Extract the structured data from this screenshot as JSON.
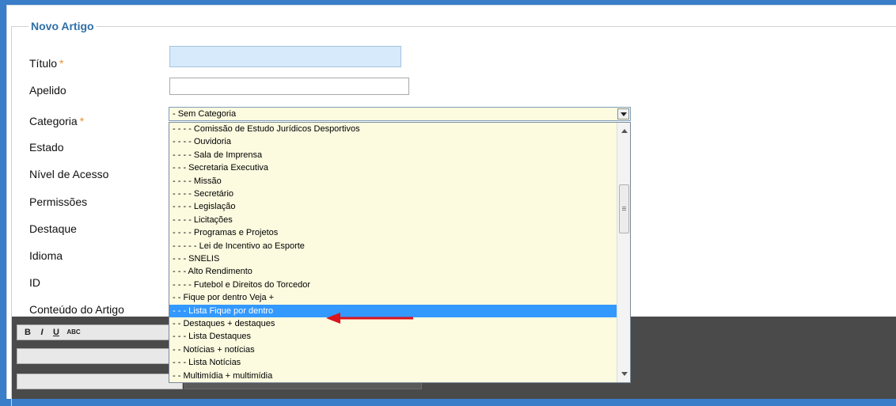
{
  "form": {
    "legend": "Novo Artigo",
    "labels": {
      "titulo": "Título",
      "apelido": "Apelido",
      "categoria": "Categoria",
      "estado": "Estado",
      "nivel": "Nível de Acesso",
      "permissoes": "Permissões",
      "destaque": "Destaque",
      "idioma": "Idioma",
      "id": "ID",
      "conteudo": "Conteúdo do Artigo"
    },
    "required_mark": "*",
    "titulo_value": "",
    "apelido_value": "",
    "categoria_selected": "- Sem Categoria"
  },
  "dropdown": {
    "options": [
      "- - - - Comissão de Estudo Jurídicos Desportivos",
      "- - - - Ouvidoria",
      "- - - - Sala de Imprensa",
      "- - - Secretaria Executiva",
      "- - - - Missão",
      "- - - - Secretário",
      "- - - - Legislação",
      "- - - - Licitações",
      "- - - - Programas e Projetos",
      "- - - - - Lei de Incentivo ao Esporte",
      "- - - SNELIS",
      "- - - Alto Rendimento",
      "- - - - Futebol e Direitos do Torcedor",
      "- - Fique por dentro Veja +",
      "- - - Lista Fique por dentro",
      "- - Destaques + destaques",
      "- - - Lista Destaques",
      "- - Notícias + notícias",
      "- - - Lista Notícias",
      "- - Multimídia + multimídia"
    ],
    "highlighted_index": 14
  },
  "editor": {
    "row1": [
      "B",
      "I",
      "U",
      "ABC"
    ],
    "colors": {
      "arrow": "#d9141c",
      "highlight": "#3399ff"
    }
  }
}
